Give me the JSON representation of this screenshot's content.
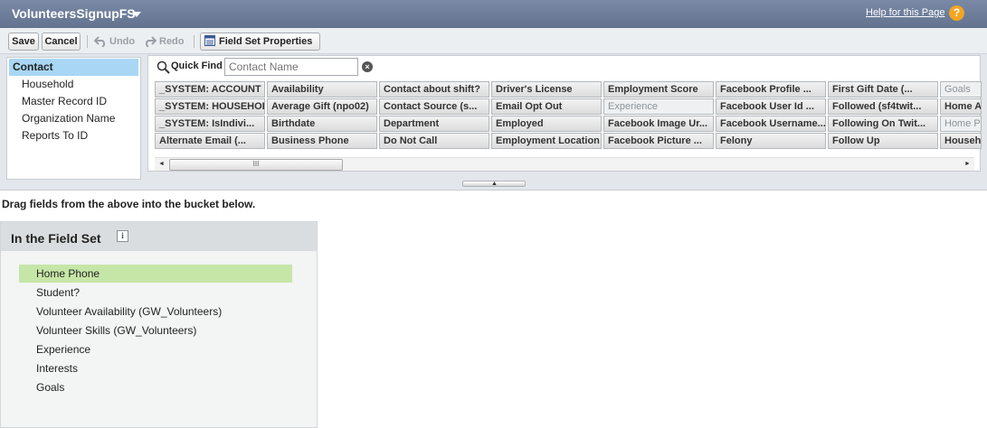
{
  "header": {
    "title": "VolunteersSignupFS",
    "help_link": "Help for this Page",
    "help_icon": "?"
  },
  "toolbar": {
    "save": "Save",
    "cancel": "Cancel",
    "undo": "Undo",
    "redo": "Redo",
    "field_set_properties": "Field Set Properties"
  },
  "objects": [
    "Contact",
    "Household",
    "Master Record ID",
    "Organization Name",
    "Reports To ID"
  ],
  "quick_find": {
    "label": "Quick Find",
    "placeholder": "Contact Name"
  },
  "field_grid": [
    [
      "_SYSTEM: ACCOUNT ...",
      "Availability",
      "Contact about shift?",
      "Driver's License",
      "Employment Score",
      "Facebook Profile ...",
      "First Gift Date (...",
      "Goals"
    ],
    [
      "_SYSTEM: HOUSEHOL...",
      "Average Gift (npo02)",
      "Contact Source (s...",
      "Email Opt Out",
      "Experience",
      "Facebook User Id ...",
      "Followed (sf4twit...",
      "Home A"
    ],
    [
      "_SYSTEM: IsIndivi...",
      "Birthdate",
      "Department",
      "Employed",
      "Facebook Image Ur...",
      "Facebook Username...",
      "Following On Twit...",
      "Home P"
    ],
    [
      "Alternate Email (...",
      "Business Phone",
      "Do Not Call",
      "Employment Location",
      "Facebook Picture ...",
      "Felony",
      "Follow Up",
      "Househ"
    ]
  ],
  "used_fields": [
    "Goals",
    "Experience",
    "Home P"
  ],
  "scroll": {
    "thumb_grip": "III"
  },
  "drag_hint": "Drag fields from the above into the bucket below.",
  "bucket": {
    "title": "In the Field Set",
    "info_icon": "i",
    "items": [
      "Home Phone",
      "Student?",
      "Volunteer Availability (GW_Volunteers)",
      "Volunteer Skills (GW_Volunteers)",
      "Experience",
      "Interests",
      "Goals"
    ]
  }
}
